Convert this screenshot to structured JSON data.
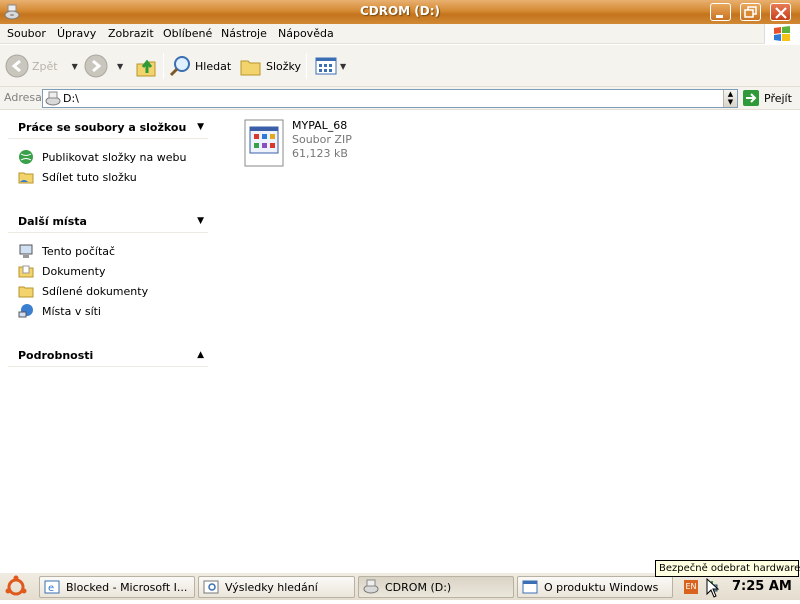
{
  "window": {
    "title": "CDROM (D:)"
  },
  "menu": [
    "Soubor",
    "Úpravy",
    "Zobrazit",
    "Oblíbené",
    "Nástroje",
    "Nápověda"
  ],
  "toolbar": {
    "back_label": "Zpět",
    "search_label": "Hledat",
    "folders_label": "Složky"
  },
  "address": {
    "label": "Adresa",
    "value": "D:\\",
    "go_label": "Přejít"
  },
  "left_pane": {
    "sections": [
      {
        "title": "Práce se soubory a složkou",
        "items": [
          "Publikovat složky na webu",
          "Sdílet tuto složku"
        ]
      },
      {
        "title": "Další místa",
        "items": [
          "Tento počítač",
          "Dokumenty",
          "Sdílené dokumenty",
          "Místa v síti"
        ]
      },
      {
        "title": "Podrobnosti",
        "items": []
      }
    ]
  },
  "files": [
    {
      "name": "MYPAL_68",
      "type": "Soubor ZIP",
      "size": "61,123 kB"
    }
  ],
  "taskbar": {
    "buttons": [
      {
        "label": "Blocked - Microsoft I...",
        "icon": "ie-icon"
      },
      {
        "label": "Výsledky hledání",
        "icon": "search-results-icon"
      },
      {
        "label": "CDROM (D:)",
        "icon": "cdrom-icon",
        "active": true
      },
      {
        "label": "O produktu Windows",
        "icon": "window-icon"
      }
    ],
    "lang": "EN",
    "clock": "7:25 AM"
  },
  "tooltip": "Bezpečně odebrat hardware",
  "colors": {
    "titlebar": "#d58a33",
    "addr_border": "#7f9db9",
    "go_green": "#2e9a3a"
  }
}
